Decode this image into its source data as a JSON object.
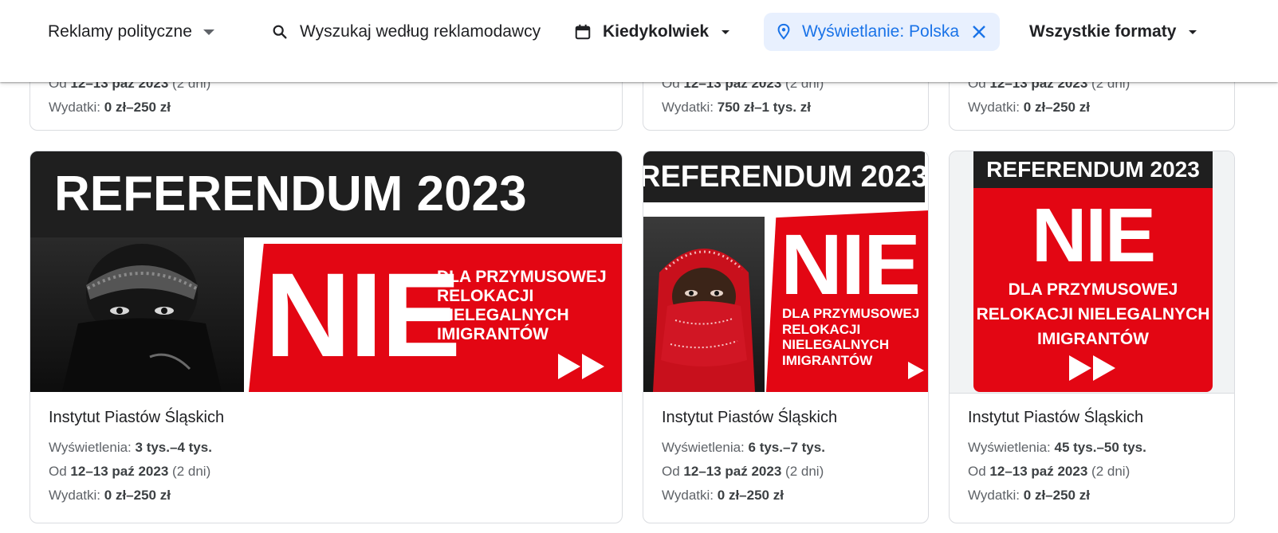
{
  "topbar": {
    "category": "Reklamy polityczne",
    "search_placeholder": "Wyszukaj według reklamodawcy",
    "date": "Kiedykolwiek",
    "location": "Wyświetlanie: Polska",
    "format": "Wszystkie formaty"
  },
  "labels": {
    "impressions": "Wyświetlenia:",
    "from": "Od",
    "spend": "Wydatki:"
  },
  "top_row": [
    {
      "date_partial": "12–13 paź 2023",
      "duration_partial": "(2 dni)",
      "spend": "0 zł–250 zł"
    },
    {
      "date_partial": "12–13 paź 2023",
      "duration_partial": "(2 dni)",
      "spend": "750 zł–1 tys. zł"
    },
    {
      "date_partial": "12–13 paź 2023",
      "duration_partial": "(2 dni)",
      "spend": "0 zł–250 zł"
    }
  ],
  "ad_image": {
    "headline": "REFERENDUM 2023",
    "big_word": "NIE",
    "line1": "DLA PRZYMUSOWEJ",
    "line2": "RELOKACJI",
    "line3": "NIELEGALNYCH",
    "line4": "IMIGRANTÓW",
    "line2_combined": "RELOKACJI NIELEGALNYCH"
  },
  "ads": [
    {
      "advertiser": "Instytut Piastów Śląskich",
      "impressions": "3 tys.–4 tys.",
      "dates": "12–13 paź 2023",
      "duration": "(2 dni)",
      "spend": "0 zł–250 zł"
    },
    {
      "advertiser": "Instytut Piastów Śląskich",
      "impressions": "6 tys.–7 tys.",
      "dates": "12–13 paź 2023",
      "duration": "(2 dni)",
      "spend": "0 zł–250 zł"
    },
    {
      "advertiser": "Instytut Piastów Śląskich",
      "impressions": "45 tys.–50 tys.",
      "dates": "12–13 paź 2023",
      "duration": "(2 dni)",
      "spend": "0 zł–250 zł"
    }
  ],
  "colors": {
    "accent": "#1a73e8",
    "chip_bg": "#e8f0fe",
    "ad_red": "#e30613",
    "ad_black": "#1f1f1f"
  }
}
